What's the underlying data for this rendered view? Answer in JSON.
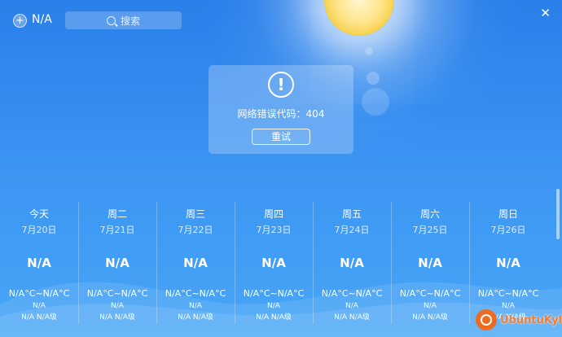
{
  "header": {
    "add_icon": "plus-icon",
    "add_symbol": "+",
    "city": "N/A",
    "search_placeholder": "搜索",
    "close_symbol": "✕"
  },
  "error": {
    "icon": "exclamation-circle-icon",
    "icon_symbol": "!",
    "message": "网络错误代码：404",
    "retry_label": "重试"
  },
  "forecast": {
    "days": [
      {
        "name": "今天",
        "date": "7月20日",
        "condition": "N/A",
        "temp": "N/A°C~N/A°C",
        "line1": "N/A",
        "line2": "N/A N/A级"
      },
      {
        "name": "周二",
        "date": "7月21日",
        "condition": "N/A",
        "temp": "N/A°C~N/A°C",
        "line1": "N/A",
        "line2": "N/A N/A级"
      },
      {
        "name": "周三",
        "date": "7月22日",
        "condition": "N/A",
        "temp": "N/A°C~N/A°C",
        "line1": "N/A",
        "line2": "N/A N/A级"
      },
      {
        "name": "周四",
        "date": "7月23日",
        "condition": "N/A",
        "temp": "N/A°C~N/A°C",
        "line1": "N/A",
        "line2": "N/A N/A级"
      },
      {
        "name": "周五",
        "date": "7月24日",
        "condition": "N/A",
        "temp": "N/A°C~N/A°C",
        "line1": "N/A",
        "line2": "N/A N/A级"
      },
      {
        "name": "周六",
        "date": "7月25日",
        "condition": "N/A",
        "temp": "N/A°C~N/A°C",
        "line1": "N/A",
        "line2": "N/A N/A级"
      },
      {
        "name": "周日",
        "date": "7月26日",
        "condition": "N/A",
        "temp": "N/A°C~N/A°C",
        "line1": "N/A",
        "line2": "N/A N/A级"
      }
    ]
  },
  "watermark": {
    "text": "UbuntuKylin"
  },
  "colors": {
    "sky_top": "#2a7fea",
    "sky_bottom": "#48a6f6",
    "logo_orange": "#f06b22"
  }
}
